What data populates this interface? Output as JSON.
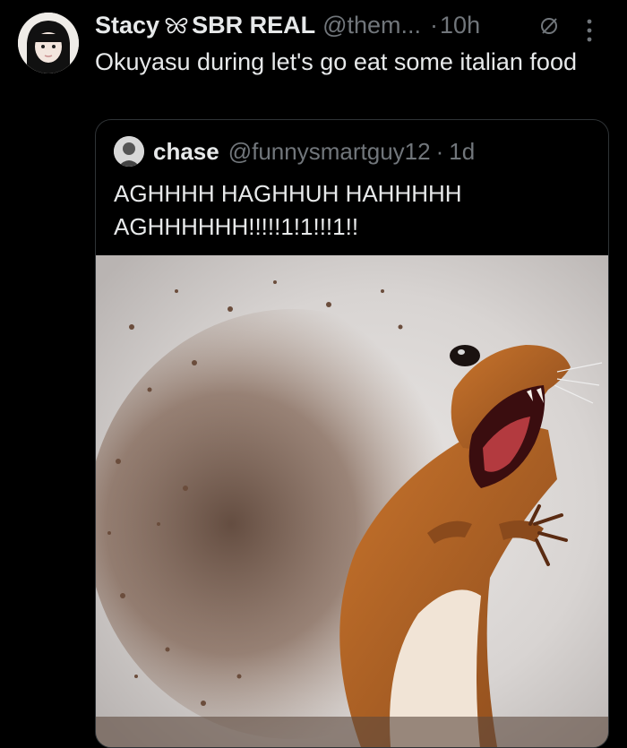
{
  "tweet": {
    "author_name": "Stacy",
    "author_name_suffix": "SBR REAL",
    "handle": "@them...",
    "separator": "·",
    "time": "10h",
    "text": "Okuyasu during let's go eat some italian food"
  },
  "quoted": {
    "author_name": "chase",
    "handle": "@funnysmartguy12",
    "separator": "·",
    "time": "1d",
    "text": "AGHHHH HAGHHUH HAHHHHH AGHHHHHH!!!!!1!1!!!1!!",
    "media_description_icon": "squirrel-image"
  },
  "colors": {
    "background": "#000000",
    "primary_text": "#e7e9ea",
    "secondary_text": "#71767b",
    "border": "#2f3336"
  },
  "icons": [
    "butterfly-icon",
    "edit-icon",
    "more-icon"
  ]
}
